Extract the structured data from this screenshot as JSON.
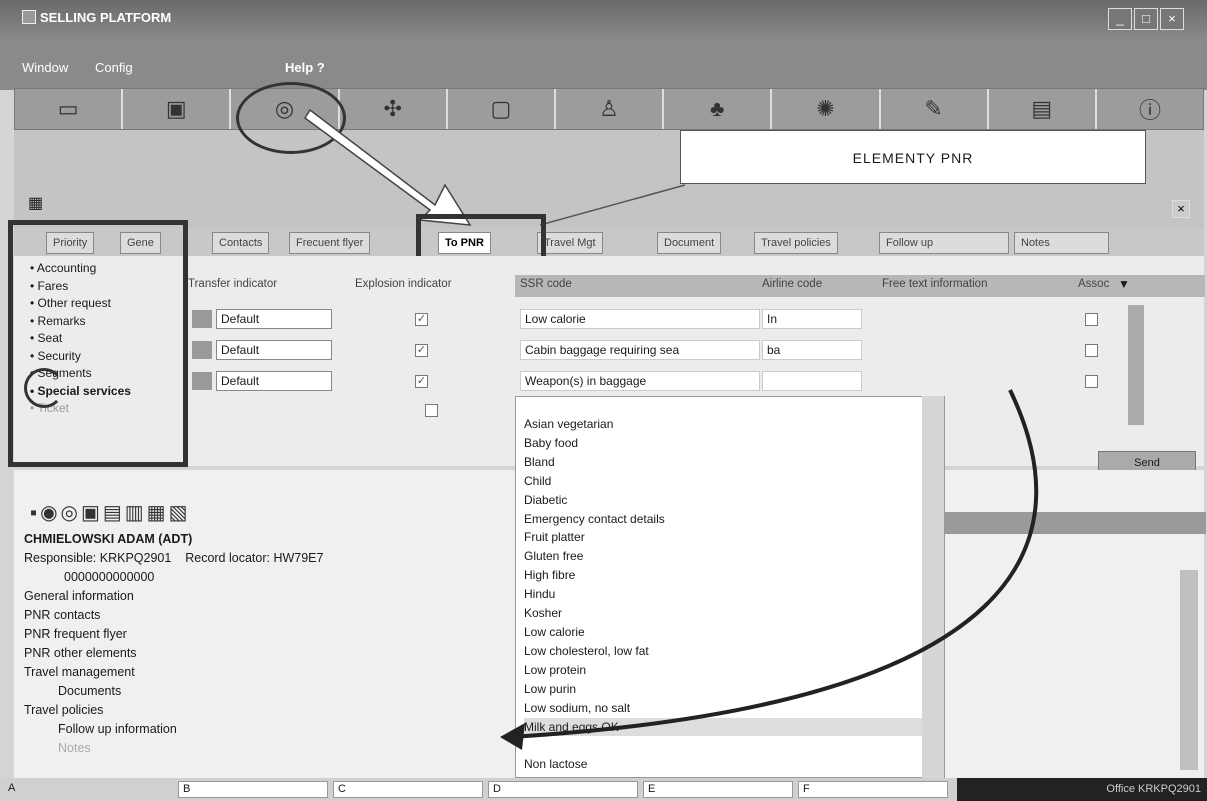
{
  "app": {
    "title": "SELLING PLATFORM"
  },
  "menu": {
    "window": "Window",
    "config": "Config",
    "help": "Help ?"
  },
  "toolbar_icons": [
    "book-icon",
    "bag-icon",
    "globe-user-icon",
    "network-icon",
    "car-icon",
    "person-icon",
    "palm-icon",
    "sun-icon",
    "pencil-icon",
    "document-icon",
    "info-icon"
  ],
  "annotation": {
    "box_label": "ELEMENTY  PNR"
  },
  "tabs": [
    "Priority",
    "Gene",
    "Contacts",
    "Frecuent flyer",
    "To PNR",
    "Travel Mgt",
    "Document",
    "Travel policies",
    "Follow up",
    "Notes"
  ],
  "sidebar": [
    "Accounting",
    "Fares",
    "Other request",
    "Remarks",
    "Seat",
    "Security",
    "Segments",
    "Special services",
    "Ticket"
  ],
  "grid": {
    "headers": [
      "Transfer indicator",
      "Explosion indicator",
      "SSR code",
      "Airline code",
      "Free text information",
      "Assoc"
    ],
    "rows": [
      {
        "transfer": "Default",
        "ssr": "Low calorie",
        "airline": "In"
      },
      {
        "transfer": "Default",
        "ssr": "Cabin baggage requiring sea",
        "airline": "ba"
      },
      {
        "transfer": "Default",
        "ssr": "Weapon(s) in baggage",
        "airline": ""
      }
    ]
  },
  "ssr_list": [
    "Asian vegetarian",
    "Baby food",
    "Bland",
    "Child",
    "Diabetic",
    "Emergency contact details",
    "Fruit platter",
    "Gluten free",
    "High fibre",
    "Hindu",
    "Kosher",
    "Low calorie",
    "Low cholesterol, low fat",
    "Low protein",
    "Low purin",
    "Low sodium, no salt",
    "Milk and eggs OK",
    "",
    "Non lactose"
  ],
  "buttons": {
    "send": "Send"
  },
  "pnr": {
    "name": "CHMIELOWSKI ADAM (ADT)",
    "responsible": "Responsible: KRKPQ2901",
    "locator": "Record locator: HW79E7",
    "code": "0000000000000",
    "items": [
      "General information",
      "PNR contacts",
      "PNR frequent flyer",
      "PNR other elements",
      "Travel management",
      "Documents",
      "Travel policies",
      "Follow up information",
      "Notes"
    ]
  },
  "status": {
    "fields": [
      "A",
      "B",
      "C",
      "D",
      "E",
      "F"
    ],
    "office": "Office  KRKPQ2901"
  }
}
